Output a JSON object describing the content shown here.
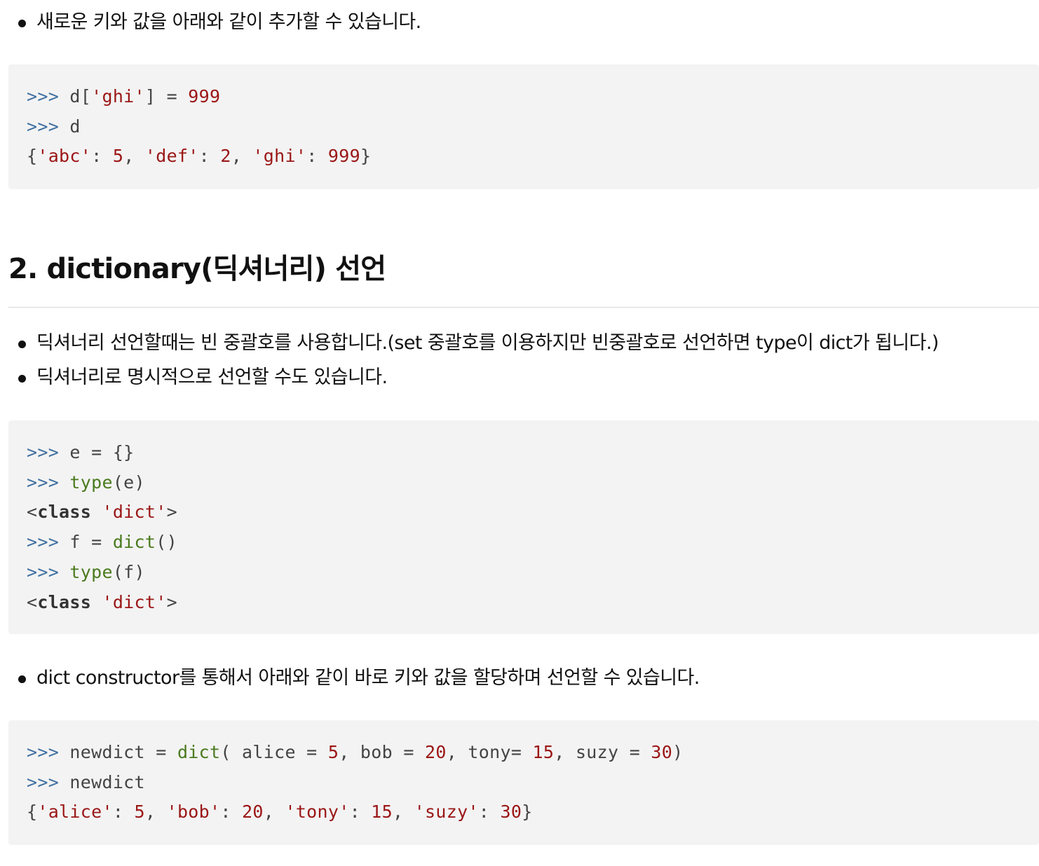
{
  "intro": {
    "bullet": "새로운 키와 값을 아래와 같이 추가할 수 있습니다."
  },
  "code1": {
    "prompt": ">>>",
    "line1": {
      "a": "d[",
      "b": "'ghi'",
      "c": "] = ",
      "d": "999"
    },
    "line2": {
      "a": "d"
    },
    "line3": {
      "o": "{",
      "k1": "'abc'",
      "s1": ": ",
      "v1": "5",
      "c1": ", ",
      "k2": "'def'",
      "s2": ": ",
      "v2": "2",
      "c2": ", ",
      "k3": "'ghi'",
      "s3": ": ",
      "v3": "999",
      "e": "}"
    }
  },
  "section": {
    "title": "2. dictionary(딕셔너리) 선언",
    "bullets": [
      "딕셔너리 선언할때는 빈 중괄호를 사용합니다.(set 중괄호를 이용하지만 빈중괄호로 선언하면 type이 dict가 됩니다.)",
      "딕셔너리로 명시적으로 선언할 수도 있습니다."
    ]
  },
  "code2": {
    "prompt": ">>>",
    "l1": "e = {}",
    "l2_fn": "type",
    "l2_arg": "(e)",
    "l3_lt": "<",
    "l3_kw": "class",
    "l3_str": "'dict'",
    "l3_gt": ">",
    "l4_pre": "f = ",
    "l4_fn": "dict",
    "l4_post": "()",
    "l5_fn": "type",
    "l5_arg": "(f)",
    "l6_lt": "<",
    "l6_kw": "class",
    "l6_str": "'dict'",
    "l6_gt": ">"
  },
  "bullet3": "dict constructor를 통해서 아래와 같이 바로 키와 값을 할당하며 선언할 수 있습니다.",
  "code3": {
    "prompt": ">>>",
    "l1_pre": "newdict = ",
    "l1_fn": "dict",
    "l1_a": "( alice = ",
    "l1_v1": "5",
    "l1_b": ", bob = ",
    "l1_v2": "20",
    "l1_c": ", tony= ",
    "l1_v3": "15",
    "l1_d": ", suzy = ",
    "l1_v4": "30",
    "l1_e": ")",
    "l2": "newdict",
    "l3": {
      "o": "{",
      "k1": "'alice'",
      "s1": ": ",
      "v1": "5",
      "c1": ", ",
      "k2": "'bob'",
      "s2": ": ",
      "v2": "20",
      "c2": ", ",
      "k3": "'tony'",
      "s3": ": ",
      "v3": "15",
      "c3": ", ",
      "k4": "'suzy'",
      "s4": ": ",
      "v4": "30",
      "e": "}"
    }
  },
  "colors": {
    "prompt": "#3f6fa0",
    "string_number": "#9b1616",
    "builtin": "#4a7a1e",
    "code_background": "#f3f3f3"
  }
}
